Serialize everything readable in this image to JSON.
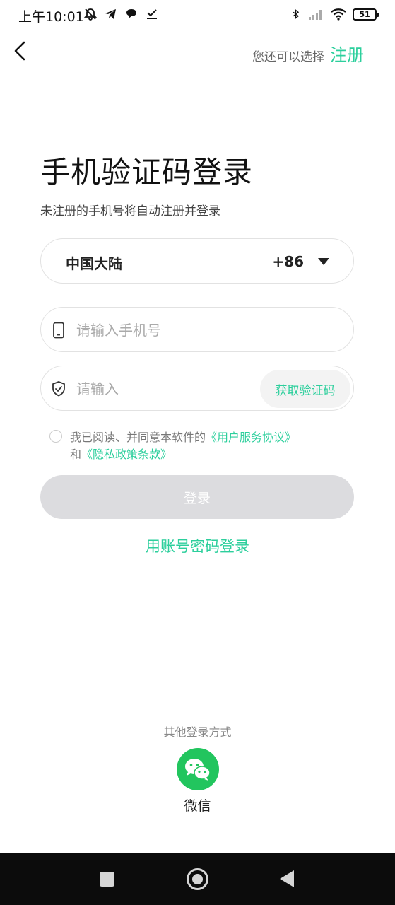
{
  "status_bar": {
    "time": "上午10:01",
    "battery": "51",
    "icons_left": [
      "bell-off-icon",
      "telegram-icon",
      "chat-bubble-icon",
      "download-check-icon"
    ],
    "icons_right": [
      "bluetooth-icon",
      "signal-icon",
      "wifi-icon",
      "battery-icon"
    ]
  },
  "header": {
    "hint": "您还可以选择",
    "register": "注册"
  },
  "title": "手机验证码登录",
  "subtitle": "未注册的手机号将自动注册并登录",
  "region": {
    "name": "中国大陆",
    "code": "+86"
  },
  "phone": {
    "placeholder": "请输入手机号",
    "value": ""
  },
  "code": {
    "placeholder": "请输入",
    "value": "",
    "get_code_label": "获取验证码"
  },
  "agreement": {
    "prefix": "我已阅读、并同意本软件的",
    "service_link": "《用户服务协议》",
    "and": "和",
    "privacy_link": "《隐私政策条款》",
    "checked": false
  },
  "login_button": "登录",
  "account_login": "用账号密码登录",
  "other_login": {
    "label": "其他登录方式",
    "wechat_label": "微信"
  },
  "colors": {
    "accent": "#2ccf9c",
    "wechat": "#22c55e",
    "login_disabled": "#dcdcdf"
  }
}
